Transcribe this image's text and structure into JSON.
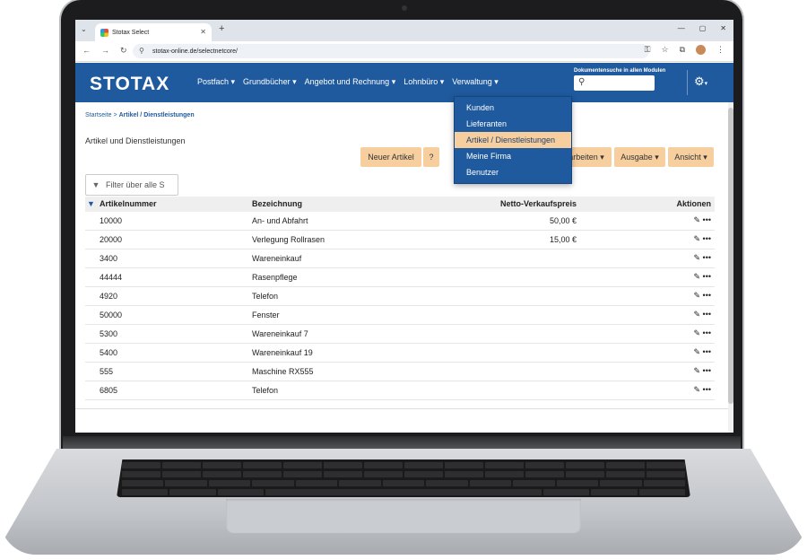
{
  "browser": {
    "tab_title": "Stotax Select",
    "tab_close": "✕",
    "new_tab": "+",
    "tab_dropdown": "⌄",
    "url": "stotax-online.de/selectnetcore/",
    "window_controls": [
      "—",
      "▢",
      "✕"
    ]
  },
  "app": {
    "logo": "STOTAX",
    "menu": [
      "Postfach ▾",
      "Grundbücher ▾",
      "Angebot und Rechnung ▾",
      "Lohnbüro ▾",
      "Verwaltung ▾"
    ],
    "doc_search_label": "Dokumentensuche in allen Modulen",
    "settings": "⚙"
  },
  "verwaltung_dropdown": {
    "items": [
      "Kunden",
      "Lieferanten",
      "Artikel / Dienstleistungen",
      "Meine Firma",
      "Benutzer"
    ],
    "active_index": 2
  },
  "breadcrumb": {
    "home": "Startseite",
    "separator": ">",
    "current": "Artikel / Dienstleistungen"
  },
  "page": {
    "title": "Artikel und Dienstleistungen",
    "buttons": {
      "new_article": "Neuer Artikel",
      "help": "?",
      "edit": "arbeiten ▾",
      "output": "Ausgabe ▾",
      "view": "Ansicht ▾"
    },
    "filter_placeholder": "Filter über alle S"
  },
  "table": {
    "headers": [
      "Artikelnummer",
      "Bezeichnung",
      "Netto-Verkaufspreis",
      "Aktionen"
    ],
    "rows": [
      {
        "nr": "10000",
        "name": "An- und Abfahrt",
        "price": "50,00 €"
      },
      {
        "nr": "20000",
        "name": "Verlegung Rollrasen",
        "price": "15,00 €"
      },
      {
        "nr": "3400",
        "name": "Wareneinkauf",
        "price": ""
      },
      {
        "nr": "44444",
        "name": "Rasenpflege",
        "price": ""
      },
      {
        "nr": "4920",
        "name": "Telefon",
        "price": ""
      },
      {
        "nr": "50000",
        "name": "Fenster",
        "price": ""
      },
      {
        "nr": "5300",
        "name": "Wareneinkauf 7",
        "price": ""
      },
      {
        "nr": "5400",
        "name": "Wareneinkauf 19",
        "price": ""
      },
      {
        "nr": "555",
        "name": "Maschine RX555",
        "price": ""
      },
      {
        "nr": "6805",
        "name": "Telefon",
        "price": ""
      }
    ],
    "action_icons": [
      "edit-icon",
      "more-icon"
    ]
  },
  "colors": {
    "header_blue": "#1f5a9e",
    "button_orange": "#f7cf9f"
  }
}
